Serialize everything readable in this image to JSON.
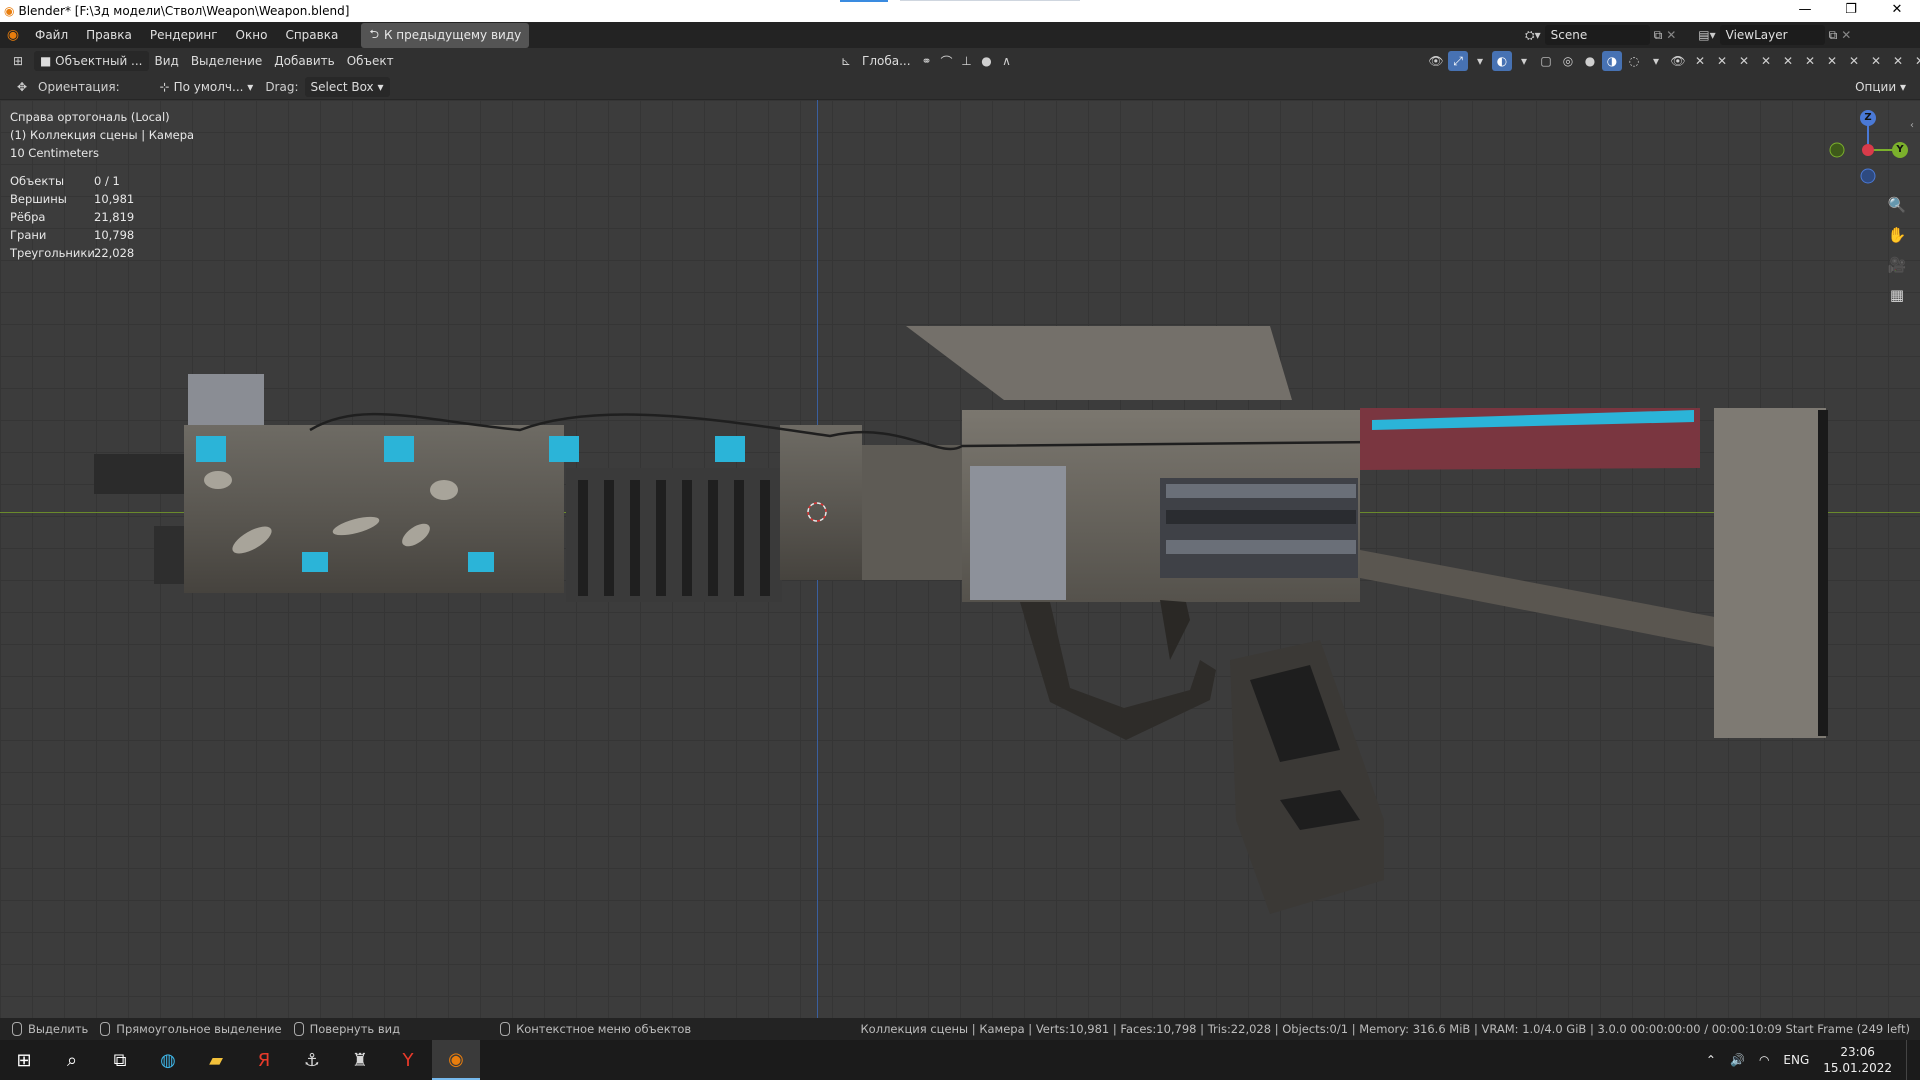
{
  "window": {
    "title": "Blender* [F:\\3д модели\\Ствол\\Weapon\\Weapon.blend]",
    "minimize": "—",
    "restore": "❐",
    "close": "✕"
  },
  "menubar": {
    "items": [
      "Файл",
      "Правка",
      "Рендеринг",
      "Окно",
      "Справка"
    ],
    "prev_view": "К предыдущему виду",
    "scene": "Scene",
    "view_layer": "ViewLayer"
  },
  "viewport_header": {
    "mode": "Объектный ...",
    "menus": [
      "Вид",
      "Выделение",
      "Добавить",
      "Объект"
    ],
    "transform_orientation": "Глоба...",
    "active_icon_color": "#4772b3"
  },
  "tool_header": {
    "orientation_label": "Ориентация:",
    "pivot": "По умолч...",
    "drag_label": "Drag:",
    "drag_value": "Select Box",
    "options": "Опции"
  },
  "overlay": {
    "view_name": "Справа ортогональ (Local)",
    "collection": "(1) Коллекция сцены | Камера",
    "scale": "10 Centimeters",
    "stats": [
      {
        "label": "Объекты",
        "value": "0 / 1"
      },
      {
        "label": "Вершины",
        "value": "10,981"
      },
      {
        "label": "Рёбра",
        "value": "21,819"
      },
      {
        "label": "Грани",
        "value": "10,798"
      },
      {
        "label": "Треугольники",
        "value": "22,028"
      }
    ]
  },
  "gizmo": {
    "z": "Z",
    "y": "Y"
  },
  "statusbar": {
    "select": "Выделить",
    "box_select": "Прямоугольное выделение",
    "rotate_view": "Повернуть вид",
    "context_menu": "Контекстное меню объектов",
    "info": "Коллекция сцены | Камера | Verts:10,981 | Faces:10,798 | Tris:22,028 | Objects:0/1 | Memory: 316.6 MiB | VRAM: 1.0/4.0 GiB | 3.0.0  00:00:00:00 / 00:00:10:09  Start Frame (249 left)"
  },
  "taskbar": {
    "lang": "ENG",
    "time": "23:06",
    "date": "15.01.2022"
  }
}
